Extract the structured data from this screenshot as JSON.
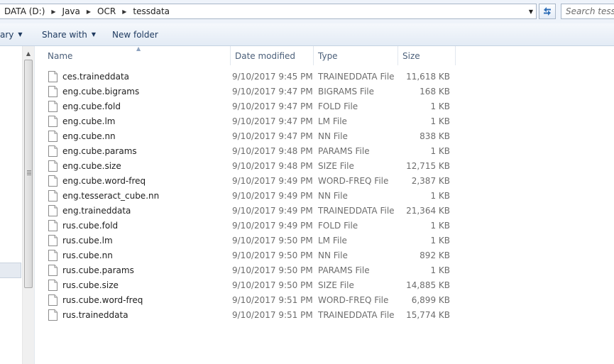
{
  "address": {
    "breadcrumbs": [
      "DATA (D:)",
      "Java",
      "OCR",
      "tessdata"
    ]
  },
  "search": {
    "placeholder": "Search tessdata"
  },
  "toolbar": {
    "library_label": "ary",
    "share_label": "Share with",
    "new_folder_label": "New folder"
  },
  "columns": {
    "name": "Name",
    "date": "Date modified",
    "type": "Type",
    "size": "Size"
  },
  "files": [
    {
      "name": "ces.traineddata",
      "date": "9/10/2017 9:45 PM",
      "type": "TRAINEDDATA File",
      "size": "11,618 KB"
    },
    {
      "name": "eng.cube.bigrams",
      "date": "9/10/2017 9:47 PM",
      "type": "BIGRAMS File",
      "size": "168 KB"
    },
    {
      "name": "eng.cube.fold",
      "date": "9/10/2017 9:47 PM",
      "type": "FOLD File",
      "size": "1 KB"
    },
    {
      "name": "eng.cube.lm",
      "date": "9/10/2017 9:47 PM",
      "type": "LM File",
      "size": "1 KB"
    },
    {
      "name": "eng.cube.nn",
      "date": "9/10/2017 9:47 PM",
      "type": "NN File",
      "size": "838 KB"
    },
    {
      "name": "eng.cube.params",
      "date": "9/10/2017 9:48 PM",
      "type": "PARAMS File",
      "size": "1 KB"
    },
    {
      "name": "eng.cube.size",
      "date": "9/10/2017 9:48 PM",
      "type": "SIZE File",
      "size": "12,715 KB"
    },
    {
      "name": "eng.cube.word-freq",
      "date": "9/10/2017 9:49 PM",
      "type": "WORD-FREQ File",
      "size": "2,387 KB"
    },
    {
      "name": "eng.tesseract_cube.nn",
      "date": "9/10/2017 9:49 PM",
      "type": "NN File",
      "size": "1 KB"
    },
    {
      "name": "eng.traineddata",
      "date": "9/10/2017 9:49 PM",
      "type": "TRAINEDDATA File",
      "size": "21,364 KB"
    },
    {
      "name": "rus.cube.fold",
      "date": "9/10/2017 9:49 PM",
      "type": "FOLD File",
      "size": "1 KB"
    },
    {
      "name": "rus.cube.lm",
      "date": "9/10/2017 9:50 PM",
      "type": "LM File",
      "size": "1 KB"
    },
    {
      "name": "rus.cube.nn",
      "date": "9/10/2017 9:50 PM",
      "type": "NN File",
      "size": "892 KB"
    },
    {
      "name": "rus.cube.params",
      "date": "9/10/2017 9:50 PM",
      "type": "PARAMS File",
      "size": "1 KB"
    },
    {
      "name": "rus.cube.size",
      "date": "9/10/2017 9:50 PM",
      "type": "SIZE File",
      "size": "14,885 KB"
    },
    {
      "name": "rus.cube.word-freq",
      "date": "9/10/2017 9:51 PM",
      "type": "WORD-FREQ File",
      "size": "6,899 KB"
    },
    {
      "name": "rus.traineddata",
      "date": "9/10/2017 9:51 PM",
      "type": "TRAINEDDATA File",
      "size": "15,774 KB"
    }
  ],
  "icons": {
    "breadcrumb_separator": "chevron-right-icon",
    "address_dropdown": "chevron-down-icon",
    "refresh": "refresh-icon",
    "file": "file-icon",
    "sort": "sort-ascending-icon",
    "scroll_up": "scroll-up-arrow-icon"
  },
  "colors": {
    "toolbar_text": "#1e3a60",
    "header_text": "#4c607a",
    "secondary_text": "#6d6d6d"
  }
}
